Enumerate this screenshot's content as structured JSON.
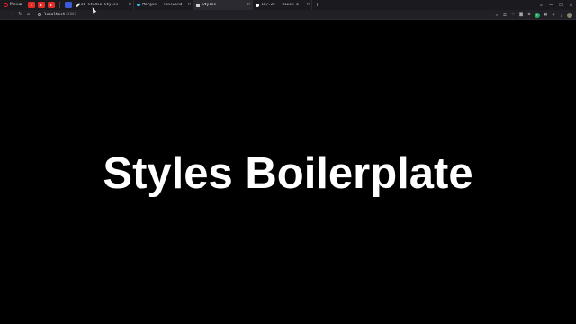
{
  "browser": {
    "menu_label": "Меню",
    "pinned": [
      {
        "name": "youtube-pinned-1",
        "color": "#e52d27"
      },
      {
        "name": "youtube-pinned-2",
        "color": "#e52d27"
      },
      {
        "name": "youtube-pinned-3",
        "color": "#e52d27"
      },
      {
        "name": "blue-pinned",
        "color": "#3b5bdb"
      }
    ],
    "tabs": [
      {
        "title": "26 Studio Styles",
        "fav_color": "#f0f0f0",
        "active": false
      },
      {
        "title": "Margin - Tailwind",
        "fav_color": "#38bdf8",
        "active": false
      },
      {
        "title": "Styles",
        "fav_color": "#cccccc",
        "active": true
      },
      {
        "title": "16/.25 - Поиск в",
        "fav_color": "#ffffff",
        "active": false
      }
    ],
    "new_tab": "+",
    "window_controls": [
      "⌕",
      "—",
      "☐",
      "✕"
    ],
    "address": {
      "host": "localhost",
      "port": ":3001"
    },
    "nav": {
      "back": "‹",
      "forward": "›",
      "reload": "↻",
      "home": "⌂"
    }
  },
  "page": {
    "heading": "Styles Boilerplate",
    "background": "#000000",
    "text_color": "#ffffff"
  }
}
